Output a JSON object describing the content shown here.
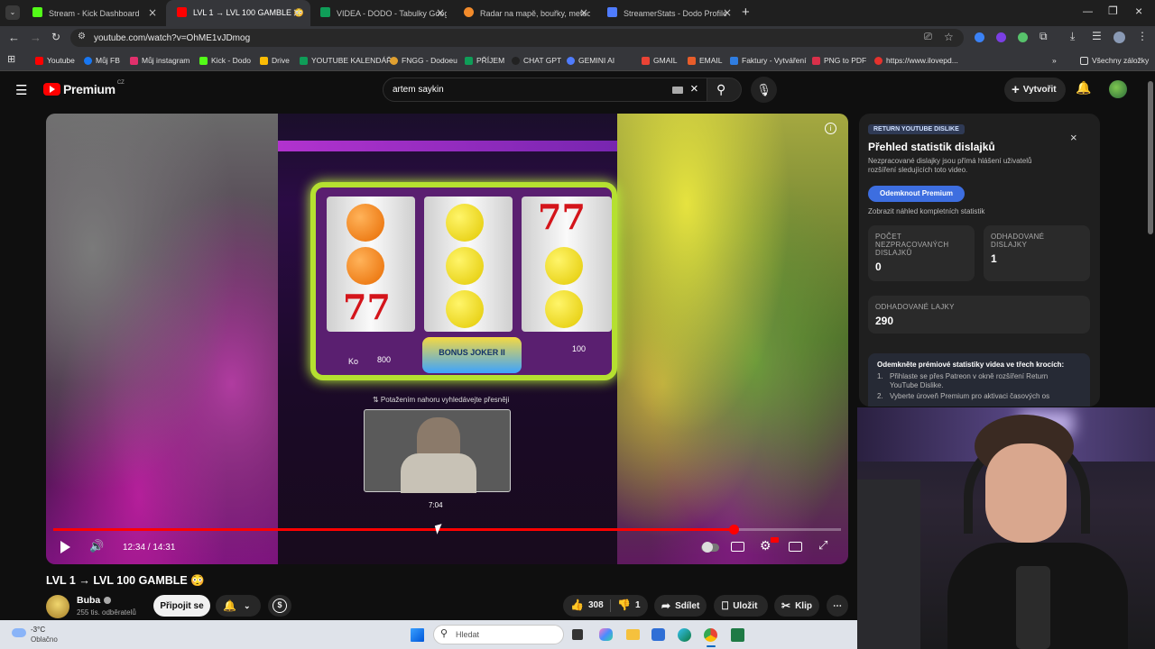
{
  "browser": {
    "tabs": [
      {
        "label": "Stream - Kick Dashboard",
        "color": "#53fc18"
      },
      {
        "label": "LVL 1 → LVL 100 GAMBLE 😳 -",
        "color": "#ff0000"
      },
      {
        "label": "VIDEA - DODO - Tabulky Googl",
        "color": "#0f9d58"
      },
      {
        "label": "Radar na mapě, bouřky, meteo",
        "color": "#f28b2b"
      },
      {
        "label": "StreamerStats - Dodo Profile",
        "color": "#4f7cff"
      }
    ],
    "url": "youtube.com/watch?v=OhME1vJDmog",
    "bookmarks": [
      {
        "label": "Youtube",
        "color": "#ff0000"
      },
      {
        "label": "Můj FB",
        "color": "#1877f2"
      },
      {
        "label": "Můj instagram",
        "color": "#e1306c"
      },
      {
        "label": "Kick - Dodo",
        "color": "#53fc18"
      },
      {
        "label": "Drive",
        "color": "#fbbc04"
      },
      {
        "label": "YOUTUBE KALENDÁŘ",
        "color": "#0f9d58"
      },
      {
        "label": "FNGG - Dodoeu",
        "color": "#e0a030"
      },
      {
        "label": "PŘÍJEM",
        "color": "#0f9d58"
      },
      {
        "label": "CHAT GPT",
        "color": "#222222"
      },
      {
        "label": "GEMINI AI",
        "color": "#4f7cff"
      },
      {
        "label": "GMAIL",
        "color": "#ea4335"
      },
      {
        "label": "EMAIL",
        "color": "#e85d2a"
      },
      {
        "label": "Faktury - Vytváření",
        "color": "#2f7de1"
      },
      {
        "label": "PNG to PDF",
        "color": "#d9304a"
      },
      {
        "label": "https://www.ilovepd...",
        "color": "#e5322d"
      }
    ],
    "all_bookmarks": "Všechny záložky"
  },
  "youtube": {
    "logo_text": "Premium",
    "logo_sup": "CZ",
    "search_value": "artem saykin",
    "create_label": "Vytvořit"
  },
  "player": {
    "time": "12:34 / 14:31",
    "hover_time": "7:04",
    "drag_hint": "⇅ Potažením nahoru vyhledávejte přesněji",
    "progress": 0.864,
    "hover_fraction": 0.49,
    "machine_left": "Ko",
    "machine_credit": "800",
    "machine_bet": "100",
    "machine_logo": "BONUS JOKER II"
  },
  "ryd_panel": {
    "badge": "RETURN YOUTUBE DISLIKE",
    "title": "Přehled statistik dislajků",
    "description": "Nezpracované dislajky jsou přímá hlášení uživatelů rozšíření sledujících toto video.",
    "unlock_button": "Odemknout Premium",
    "preview_link": "Zobrazit náhled kompletních statistik",
    "stats": [
      {
        "label": "POČET NEZPRACOVANÝCH DISLAJKŮ",
        "value": "0"
      },
      {
        "label": "ODHADOVANÉ DISLAJKY",
        "value": "1"
      },
      {
        "label": "ODHADOVANÉ LAJKY",
        "value": "290"
      }
    ],
    "steps_title": "Odemkněte prémiové statistiky videa ve třech krocích:",
    "steps": [
      "Přihlaste se přes Patreon v okně rozšíření Return YouTube Dislike.",
      "Vyberte úroveň Premium pro aktivaci časových os"
    ]
  },
  "video_info": {
    "title": "LVL 1 → LVL 100 GAMBLE 😳",
    "channel_name": "Buba",
    "subscribers": "255 tis. odběratelů",
    "join_label": "Připojit se",
    "likes": "308",
    "dislikes": "1",
    "share_label": "Sdílet",
    "save_label": "Uložit",
    "clip_label": "Klip"
  },
  "taskbar": {
    "temperature": "-3°C",
    "weather": "Oblačno",
    "search_placeholder": "Hledat"
  },
  "colors": {
    "accent": "#ff0000",
    "premium_button": "#3d6ee0"
  }
}
